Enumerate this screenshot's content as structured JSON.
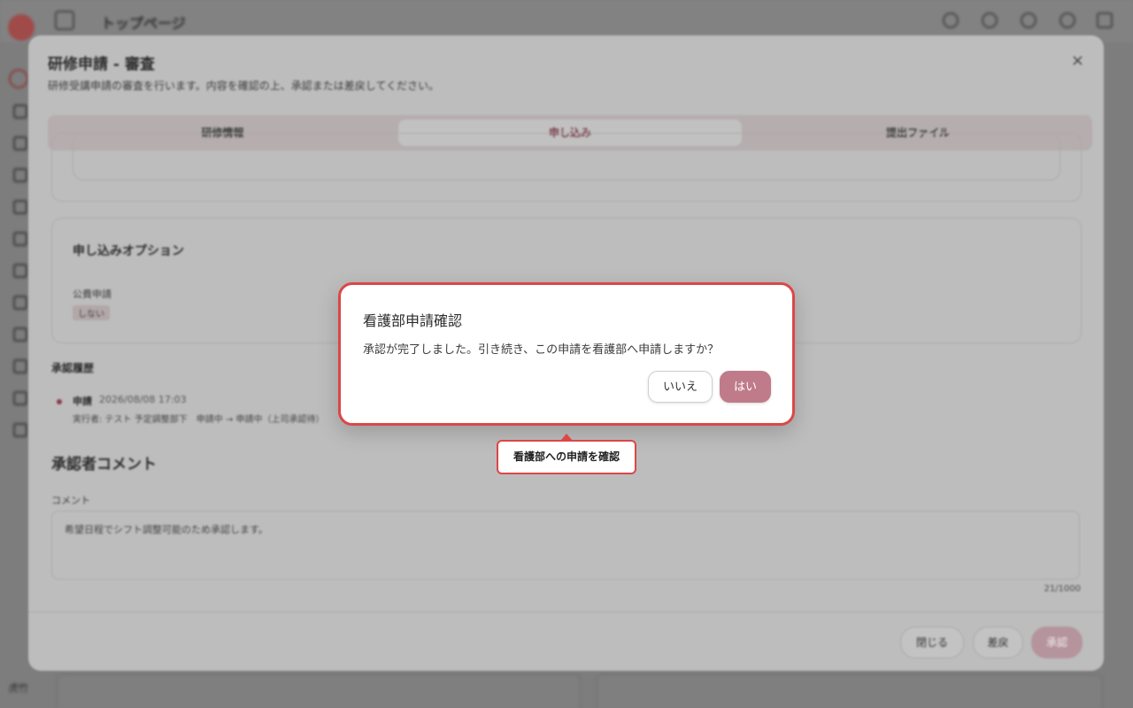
{
  "app": {
    "title": "トップページ",
    "sidebar_bottom": "虎竹"
  },
  "main_modal": {
    "title": "研修申請 - 審査",
    "description": "研修受講申請の審査を行います。内容を確認の上、承認または差戻してください。",
    "close": "×",
    "tabs": [
      {
        "label": "研修情報",
        "active": false
      },
      {
        "label": "申し込み",
        "active": true
      },
      {
        "label": "提出ファイル",
        "active": false
      }
    ],
    "options": {
      "title": "申し込みオプション",
      "field_label": "公費申請",
      "field_value": "しない"
    },
    "history": {
      "title": "承認履歴",
      "status": "申請",
      "time": "2026/08/08 17:03",
      "detail": "実行者: テスト 予定調整部下　申請中 → 申請中（上司承認待）"
    },
    "comment": {
      "title": "承認者コメント",
      "label": "コメント",
      "value": "希望日程でシフト調整可能のため承認します。",
      "count": "21/1000"
    },
    "footer": {
      "close_label": "閉じる",
      "reject_label": "差戻",
      "approve_label": "承認"
    }
  },
  "confirm_dialog": {
    "title": "看護部申請確認",
    "message": "承認が完了しました。引き続き、この申請を看護部へ申請しますか？",
    "no_label": "いいえ",
    "yes_label": "はい"
  },
  "callout": {
    "label": "看護部への申請を確認"
  },
  "colors": {
    "accent": "#c07b8b",
    "highlight": "#dc4747"
  }
}
